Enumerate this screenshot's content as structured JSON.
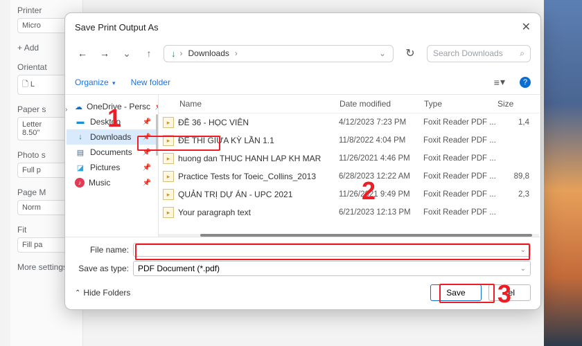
{
  "print_panel": {
    "printer_label": "Printer",
    "printer_value": "Micro",
    "add": "Add",
    "orientation_label": "Orientat",
    "layout_value": "L",
    "paper_size_label": "Paper s",
    "paper_letter": "Letter",
    "paper_dim": "8.50\"",
    "photo_label": "Photo s",
    "photo_value": "Full p",
    "page_m_label": "Page M",
    "page_m_value": "Norm",
    "fit_label": "Fit",
    "fit_value": "Fill pa",
    "more_label": "More settings"
  },
  "dialog": {
    "title": "Save Print Output As",
    "path": "Downloads",
    "path_sep": "›",
    "path_chev": "⌄",
    "search_placeholder": "Search Downloads",
    "toolbar": {
      "organize": "Organize",
      "newfolder": "New folder"
    },
    "sidebar": [
      {
        "icon": "☁",
        "icon_class": "ico-cloud",
        "label": "OneDrive - Persc",
        "pin": true
      },
      {
        "icon": "▬",
        "icon_class": "ico-desktop",
        "label": "Desktop",
        "pin": true
      },
      {
        "icon": "↓",
        "icon_class": "ico-download",
        "label": "Downloads",
        "pin": true,
        "selected": true
      },
      {
        "icon": "▤",
        "icon_class": "ico-doc",
        "label": "Documents",
        "pin": true
      },
      {
        "icon": "◪",
        "icon_class": "ico-pic",
        "label": "Pictures",
        "pin": true
      },
      {
        "icon": "♪",
        "icon_class": "ico-music",
        "label": "Music",
        "pin": true
      }
    ],
    "columns": {
      "name": "Name",
      "date": "Date modified",
      "type": "Type",
      "size": "Size"
    },
    "files": [
      {
        "name": "ĐỀ 36 - HỌC VIÊN",
        "date": "4/12/2023 7:23 PM",
        "type": "Foxit Reader PDF ...",
        "size": "1,4"
      },
      {
        "name": "ĐỀ THI GIỮA KỲ LẦN 1.1",
        "date": "11/8/2022 4:04 PM",
        "type": "Foxit Reader PDF ...",
        "size": ""
      },
      {
        "name": "huong dan THUC HANH LAP KH MAR",
        "date": "11/26/2021 4:46 PM",
        "type": "Foxit Reader PDF ...",
        "size": ""
      },
      {
        "name": "Practice Tests for Toeic_Collins_2013",
        "date": "6/28/2023 12:22 AM",
        "type": "Foxit Reader PDF ...",
        "size": "89,8"
      },
      {
        "name": "QUẢN TRỊ DỰ ÁN - UPC 2021",
        "date": "11/26/2021 9:49 PM",
        "type": "Foxit Reader PDF ...",
        "size": "2,3"
      },
      {
        "name": "Your paragraph text",
        "date": "6/21/2023 12:13 PM",
        "type": "Foxit Reader PDF ...",
        "size": ""
      }
    ],
    "file_name_label": "File name:",
    "file_name_value": "",
    "save_type_label": "Save as type:",
    "save_type_value": "PDF Document (*.pdf)",
    "hide_folders": "Hide Folders",
    "save": "Save",
    "cancel": "cel"
  },
  "callouts": {
    "c1": "1",
    "c2": "2",
    "c3": "3"
  }
}
